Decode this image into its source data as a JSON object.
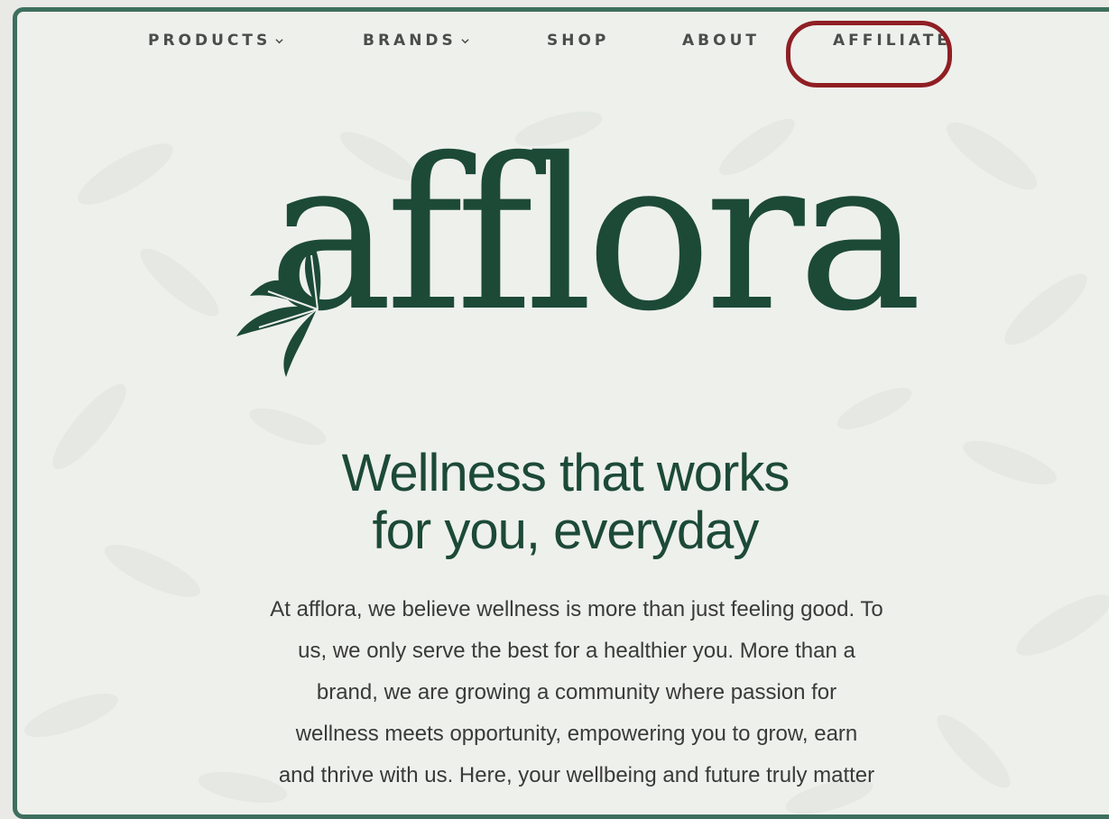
{
  "nav": {
    "items": [
      {
        "label": "PRODUCTS",
        "has_dropdown": true
      },
      {
        "label": "BRANDS",
        "has_dropdown": true
      },
      {
        "label": "SHOP",
        "has_dropdown": false
      },
      {
        "label": "ABOUT",
        "has_dropdown": false
      },
      {
        "label": "AFFILIATE",
        "has_dropdown": false,
        "highlighted": true
      }
    ]
  },
  "hero": {
    "logo_text": "afflora",
    "headline_line1": "Wellness that works",
    "headline_line2": "for you, everyday",
    "body_lines": [
      "At afflora, we believe wellness is more than just feeling good. To",
      "us, we only serve the best for a healthier you. More than a",
      "brand, we are growing a community where passion for",
      "wellness meets opportunity, empowering you to grow, earn",
      "and thrive with us. Here, your wellbeing and future truly matter"
    ]
  },
  "colors": {
    "brand_green": "#1c4a37",
    "frame_border": "#3e6f5e",
    "highlight_ring": "#8f1f24",
    "background": "#eef0ec"
  },
  "icons": [
    "chevron-down-icon",
    "flower-logo-icon"
  ]
}
